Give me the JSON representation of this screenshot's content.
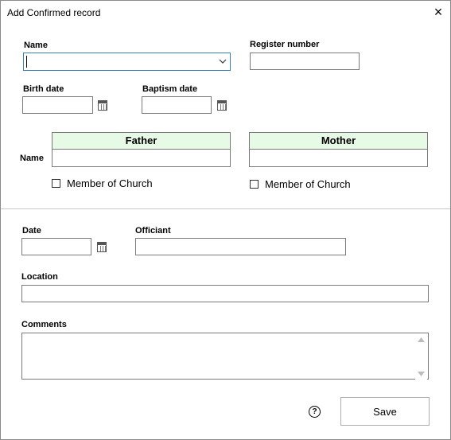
{
  "window": {
    "title": "Add Confirmed record",
    "close_icon": "×"
  },
  "form": {
    "name_label": "Name",
    "register_number_label": "Register number",
    "birth_date_label": "Birth date",
    "baptism_date_label": "Baptism date",
    "parents_name_label": "Name",
    "father_header": "Father",
    "mother_header": "Mother",
    "father_member_label": "Member of Church",
    "mother_member_label": "Member of Church",
    "date_label": "Date",
    "officiant_label": "Officiant",
    "location_label": "Location",
    "comments_label": "Comments"
  },
  "footer": {
    "help_icon": "?",
    "save_label": "Save"
  },
  "colors": {
    "header_bg": "#e7fae5",
    "focus_border": "#3c7fb1"
  }
}
